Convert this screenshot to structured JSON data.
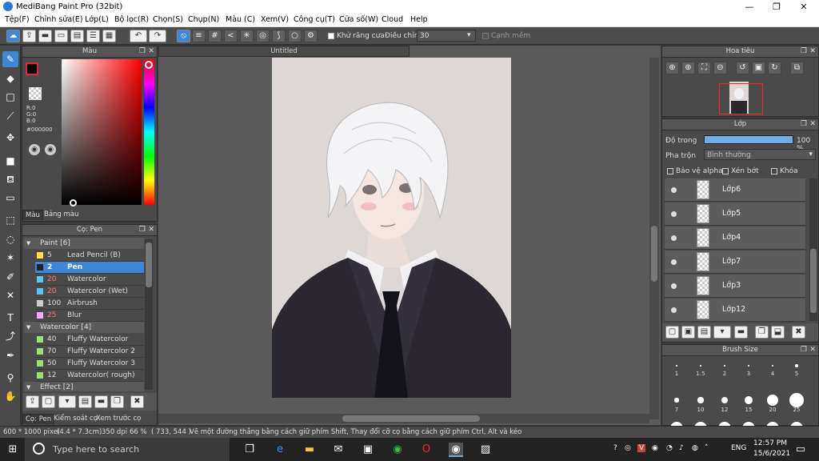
{
  "window": {
    "title": "MediBang Paint Pro (32bit)",
    "min_glyph": "—",
    "max_glyph": "❐",
    "close_glyph": "✕"
  },
  "menu": [
    "Tệp(F)",
    "Chỉnh sửa(E)",
    "Lớp(L)",
    "Bộ lọc(R)",
    "Chọn(S)",
    "Chụp(N)",
    "Màu (C)",
    "Xem(V)",
    "Công cụ(T)",
    "Cửa số(W)",
    "Cloud",
    "Help"
  ],
  "toolbar": {
    "antialias_label": "Khử răng cưa",
    "adjust_label": "Điều chỉnh",
    "adjust_value": "30",
    "dropdown_glyph": "▾",
    "edge_label": "Cạnh mềm",
    "undo_glyph": "↶",
    "redo_glyph": "↷"
  },
  "color_panel": {
    "title": "Màu",
    "r": "R:0",
    "g": "G:0",
    "b": "B:0",
    "hex": "#000000",
    "tab_color": "Màu",
    "tab_palette": "Bảng màu"
  },
  "brush_panel": {
    "title": "Cọ: Pen",
    "groups": [
      {
        "label": "Paint [6]",
        "items": [
          {
            "num": "5",
            "name": "Lead Pencil (B)",
            "color": "#ffe53b",
            "numcolor": "#dddddd",
            "sel": false
          },
          {
            "num": "2",
            "name": "Pen",
            "color": "#222222",
            "numcolor": "#ffffff",
            "sel": true
          },
          {
            "num": "20",
            "name": "Watercolor",
            "color": "#56c7f0",
            "numcolor": "#ff7a7a",
            "sel": false
          },
          {
            "num": "20",
            "name": "Watercolor (Wet)",
            "color": "#56c7f0",
            "numcolor": "#ff7a7a",
            "sel": false
          },
          {
            "num": "100",
            "name": "Airbrush",
            "color": "#cccccc",
            "numcolor": "#dddddd",
            "sel": false
          },
          {
            "num": "25",
            "name": "Blur",
            "color": "#f5a8ff",
            "numcolor": "#ff7a7a",
            "sel": false
          }
        ]
      },
      {
        "label": "Watercolor [4]",
        "items": [
          {
            "num": "40",
            "name": "Fluffy Watercolor",
            "color": "#9fe06b",
            "numcolor": "#dddddd",
            "sel": false
          },
          {
            "num": "70",
            "name": "Fluffy Watercolor 2",
            "color": "#9fe06b",
            "numcolor": "#dddddd",
            "sel": false
          },
          {
            "num": "50",
            "name": "Fluffy Watercolor 3",
            "color": "#9fe06b",
            "numcolor": "#dddddd",
            "sel": false
          },
          {
            "num": "12",
            "name": "Watercolor( rough)",
            "color": "#9fe06b",
            "numcolor": "#dddddd",
            "sel": false
          }
        ]
      },
      {
        "label": "Effect [2]",
        "items": []
      }
    ],
    "tab_pen": "Cọ: Pen",
    "tab_control": "Kiểm soát cọ",
    "tab_preview": "Xem trước cọ"
  },
  "canvas": {
    "tab_title": "Untitled"
  },
  "navigator": {
    "title": "Hoa tiêu"
  },
  "layer_panel": {
    "title": "Lớp",
    "opacity_label": "Độ trong",
    "opacity_value": "100 %",
    "opacity_fraction": 1.0,
    "blend_label": "Pha trộn",
    "blend_value": "Bình thường",
    "protect_alpha": "Bảo vệ alpha",
    "clip": "Xén bớt",
    "lock": "Khóa",
    "layers": [
      "Lớp6",
      "Lớp5",
      "Lớp4",
      "Lớp7",
      "Lớp3",
      "Lớp12"
    ]
  },
  "brush_size": {
    "title": "Brush Size",
    "row1": [
      "1",
      "1.5",
      "2",
      "3",
      "4",
      "5"
    ],
    "row2": [
      "7",
      "10",
      "12",
      "15",
      "20",
      "25"
    ]
  },
  "status": {
    "size": "600 * 1000 pixel",
    "cm": "(4.4 * 7.3cm)",
    "dpi": "350 dpi",
    "zoom": "66 %",
    "coords": "( 733, 544 )",
    "hint": "Vẽ một đường thẳng bằng cách giữ phím Shift, Thay đổi cỡ cọ bằng cách giữ phím Ctrl, Alt và kéo"
  },
  "taskbar": {
    "search_placeholder": "Type here to search",
    "lang": "ENG",
    "time": "12:57 PM",
    "date": "15/6/2021"
  },
  "colors": {
    "accent": "#3f86d6",
    "panel": "#4a4a4a",
    "canvas_bg": "#ddd8d6",
    "nav_frame": "#ff2020"
  }
}
